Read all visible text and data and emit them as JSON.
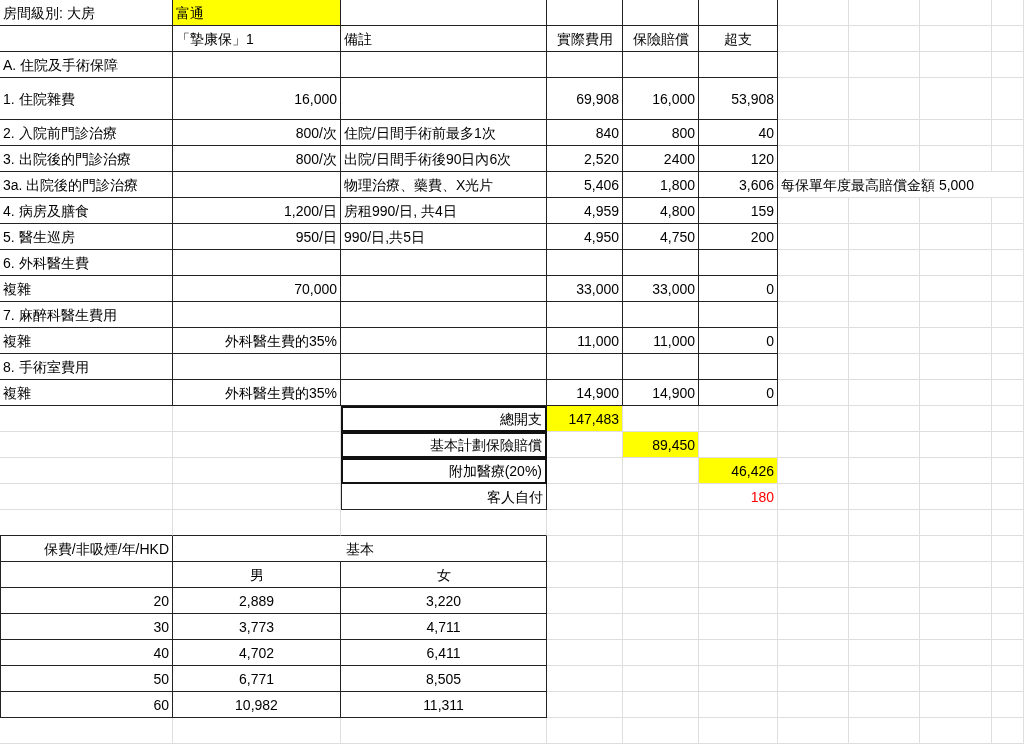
{
  "header": {
    "room_class": "房間級別: 大房",
    "provider": {
      "text": "富通",
      "highlighted": true
    }
  },
  "columns": {
    "limit": "「摯康保」1",
    "remark": "備註",
    "actual": "實際費用",
    "claim": "保險賠償",
    "excess": "超支"
  },
  "rows": [
    {
      "item": "A. 住院及手術保障"
    },
    {
      "item": "1. 住院雜費",
      "limit": "16,000",
      "actual": "69,908",
      "claim": "16,000",
      "excess": "53,908",
      "tall": true
    },
    {
      "item": "2. 入院前門診治療",
      "limit": "800/次",
      "remark": "住院/日間手術前最多1次",
      "actual": "840",
      "claim": "800",
      "excess": "40"
    },
    {
      "item": "3. 出院後的門診治療",
      "limit": "800/次",
      "remark": "出院/日間手術後90日內6次",
      "actual": "2,520",
      "claim": "2400",
      "excess": "120"
    },
    {
      "item": "3a. 出院後的門診治療",
      "remark": "物理治療、藥費、X光片",
      "actual": "5,406",
      "claim": "1,800",
      "excess": "3,606",
      "note": "每保單年度最高賠償金額 5,000"
    },
    {
      "item": "4. 病房及膳食",
      "limit": "1,200/日",
      "remark": "房租990/日, 共4日",
      "actual": "4,959",
      "claim": "4,800",
      "excess": "159"
    },
    {
      "item": "5. 醫生巡房",
      "limit": "950/日",
      "remark": "990/日,共5日",
      "actual": "4,950",
      "claim": "4,750",
      "excess": "200"
    },
    {
      "item": "6. 外科醫生費"
    },
    {
      "item": "複雜",
      "limit": "70,000",
      "actual": "33,000",
      "claim": "33,000",
      "excess": "0"
    },
    {
      "item": "7. 麻醉科醫生費用"
    },
    {
      "item": "複雜",
      "limit": "外科醫生費的35%",
      "actual": "11,000",
      "claim": "11,000",
      "excess": "0"
    },
    {
      "item": "8. 手術室費用"
    },
    {
      "item": "複雜",
      "limit": "外科醫生費的35%",
      "actual": "14,900",
      "claim": "14,900",
      "excess": "0"
    }
  ],
  "summary": [
    {
      "label": "總開支",
      "actual": "147,483",
      "highlighted": true,
      "boxed": true
    },
    {
      "label": "基本計劃保險賠償",
      "claim": "89,450",
      "highlighted": true,
      "boxed": true
    },
    {
      "label": "附加醫療(20%)",
      "excess": "46,426",
      "highlighted": true,
      "boxed": true
    },
    {
      "label": "客人自付",
      "excess": "180",
      "highlighted": false,
      "color": "#ff0000",
      "boxed": false
    }
  ],
  "premiums": {
    "title": "保費/非吸煙/年/HKD",
    "plan": "基本",
    "genders": [
      "男",
      "女"
    ],
    "rows": [
      {
        "age": "20",
        "male": "2,889",
        "female": "3,220"
      },
      {
        "age": "30",
        "male": "3,773",
        "female": "4,711"
      },
      {
        "age": "40",
        "male": "4,702",
        "female": "6,411"
      },
      {
        "age": "50",
        "male": "6,771",
        "female": "8,505"
      },
      {
        "age": "60",
        "male": "10,982",
        "female": "11,311"
      }
    ]
  }
}
